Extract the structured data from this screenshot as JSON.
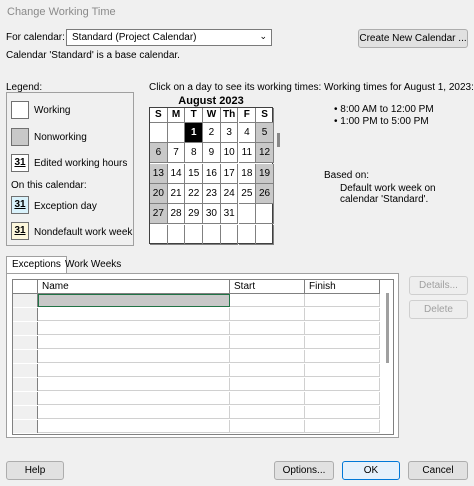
{
  "window": {
    "title": "Change Working Time"
  },
  "calendar_select": {
    "label": "For calendar:",
    "value": "Standard (Project Calendar)"
  },
  "create_calendar_button": "Create New Calendar ...",
  "base_note": "Calendar 'Standard' is a base calendar.",
  "legend": {
    "title": "Legend:",
    "working": "Working",
    "nonworking": "Nonworking",
    "edited": "Edited working hours",
    "on_calendar": "On this calendar:",
    "exception": "Exception day",
    "nondefault": "Nondefault work week",
    "swatch_day": "31"
  },
  "calendar": {
    "instruction": "Click on a day to see its working times:",
    "month": "August 2023",
    "weekdays": [
      "S",
      "M",
      "T",
      "W",
      "Th",
      "F",
      "S"
    ],
    "weeks": [
      [
        "",
        "",
        "1",
        "2",
        "3",
        "4",
        "5"
      ],
      [
        "6",
        "7",
        "8",
        "9",
        "10",
        "11",
        "12"
      ],
      [
        "13",
        "14",
        "15",
        "16",
        "17",
        "18",
        "19"
      ],
      [
        "20",
        "21",
        "22",
        "23",
        "24",
        "25",
        "26"
      ],
      [
        "27",
        "28",
        "29",
        "30",
        "31",
        "",
        ""
      ],
      [
        "",
        "",
        "",
        "",
        "",
        "",
        ""
      ]
    ],
    "selected_day": "1"
  },
  "working_times": {
    "title": "Working times for August 1, 2023:",
    "items": [
      "8:00 AM to 12:00 PM",
      "1:00 PM to 5:00 PM"
    ],
    "based_on_label": "Based on:",
    "based_on_text": "Default work week on calendar 'Standard'."
  },
  "tabs": [
    "Exceptions",
    "Work Weeks"
  ],
  "table": {
    "columns": [
      "Name",
      "Start",
      "Finish"
    ]
  },
  "side_buttons": {
    "details": "Details...",
    "delete": "Delete"
  },
  "footer": {
    "help": "Help",
    "options": "Options...",
    "ok": "OK",
    "cancel": "Cancel"
  }
}
